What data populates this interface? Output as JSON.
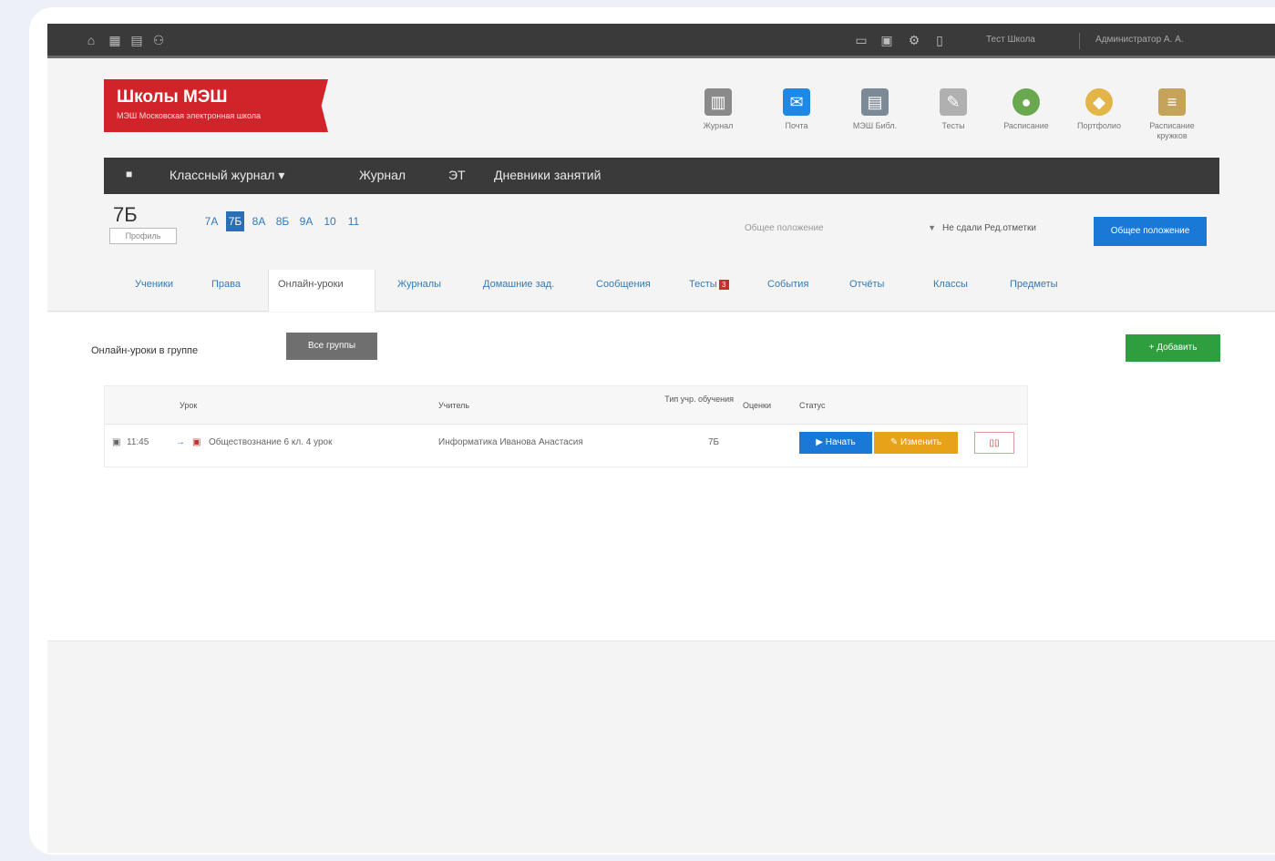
{
  "topbar": {
    "icons": [
      "home-icon",
      "calendar-icon",
      "grid-icon",
      "user-icon"
    ],
    "right_icons": [
      "mail-icon",
      "chat-icon",
      "settings-icon",
      "lock-icon"
    ],
    "school_link": "Тест Школа",
    "user_name": "Администратор А. А."
  },
  "logo": {
    "title": "Школы МЭШ",
    "subtitle": "МЭШ Московская электронная школа"
  },
  "apps": [
    {
      "label": "Журнал",
      "icon": "journal-icon",
      "color": "#8a8a8a"
    },
    {
      "label": "Почта",
      "icon": "mail-icon",
      "color": "#1e88e5"
    },
    {
      "label": "МЭШ Библ.",
      "icon": "library-icon",
      "color": "#7b8a96"
    },
    {
      "label": "Тесты",
      "icon": "test-icon",
      "color": "#b0b0b0"
    },
    {
      "label": "Расписание",
      "icon": "schedule-icon",
      "color": "#6aa84f"
    },
    {
      "label": "Портфолио",
      "icon": "portfolio-icon",
      "color": "#e3b448"
    },
    {
      "label": "Расписание кружков",
      "icon": "clubs-icon",
      "color": "#c5a35a"
    }
  ],
  "navbar": {
    "menu_icon": "grid-icon",
    "items": [
      "Классный журнал ▾",
      "Журнал",
      "ЭТ",
      "Дневники занятий"
    ]
  },
  "class_header": {
    "title": "7Б",
    "subtitle": "Профиль",
    "parallel": [
      "7А",
      "7Б",
      "8А",
      "8Б",
      "9А",
      "10",
      "11"
    ],
    "active_index": 1,
    "select_value": "Общее положение",
    "links": "Не сдали Ред.отметки",
    "button": "Общее положение"
  },
  "tabs": [
    {
      "label": "Ученики",
      "badge": ""
    },
    {
      "label": "Права",
      "badge": ""
    },
    {
      "label": "Онлайн-уроки",
      "badge": ""
    },
    {
      "label": "Журналы",
      "badge": ""
    },
    {
      "label": "Домашние зад.",
      "badge": ""
    },
    {
      "label": "Сообщения",
      "badge": ""
    },
    {
      "label": "Тесты",
      "badge": "3"
    },
    {
      "label": "События",
      "badge": ""
    },
    {
      "label": "Отчёты",
      "badge": ""
    },
    {
      "label": "Классы",
      "badge": ""
    },
    {
      "label": "Предметы",
      "badge": ""
    }
  ],
  "content": {
    "section_title": "Онлайн-уроки в группе",
    "section_button": "Все группы",
    "add_button": "+ Добавить",
    "table_headers": [
      "Урок",
      "Учитель",
      "Тип учр. обучения",
      "Оценки",
      "Статус"
    ],
    "rows": [
      {
        "time": "11:45",
        "lesson": "Обществознание 6 кл. 4 урок",
        "teacher": "Информатика Иванова Анастасия",
        "type": "7Б",
        "actions": [
          "Начать",
          "Изменить"
        ]
      }
    ]
  },
  "colors": {
    "accent_blue": "#1a78d6",
    "logo_red": "#d0242a",
    "add_green": "#2e9e3e",
    "edit_orange": "#e8a21a"
  }
}
